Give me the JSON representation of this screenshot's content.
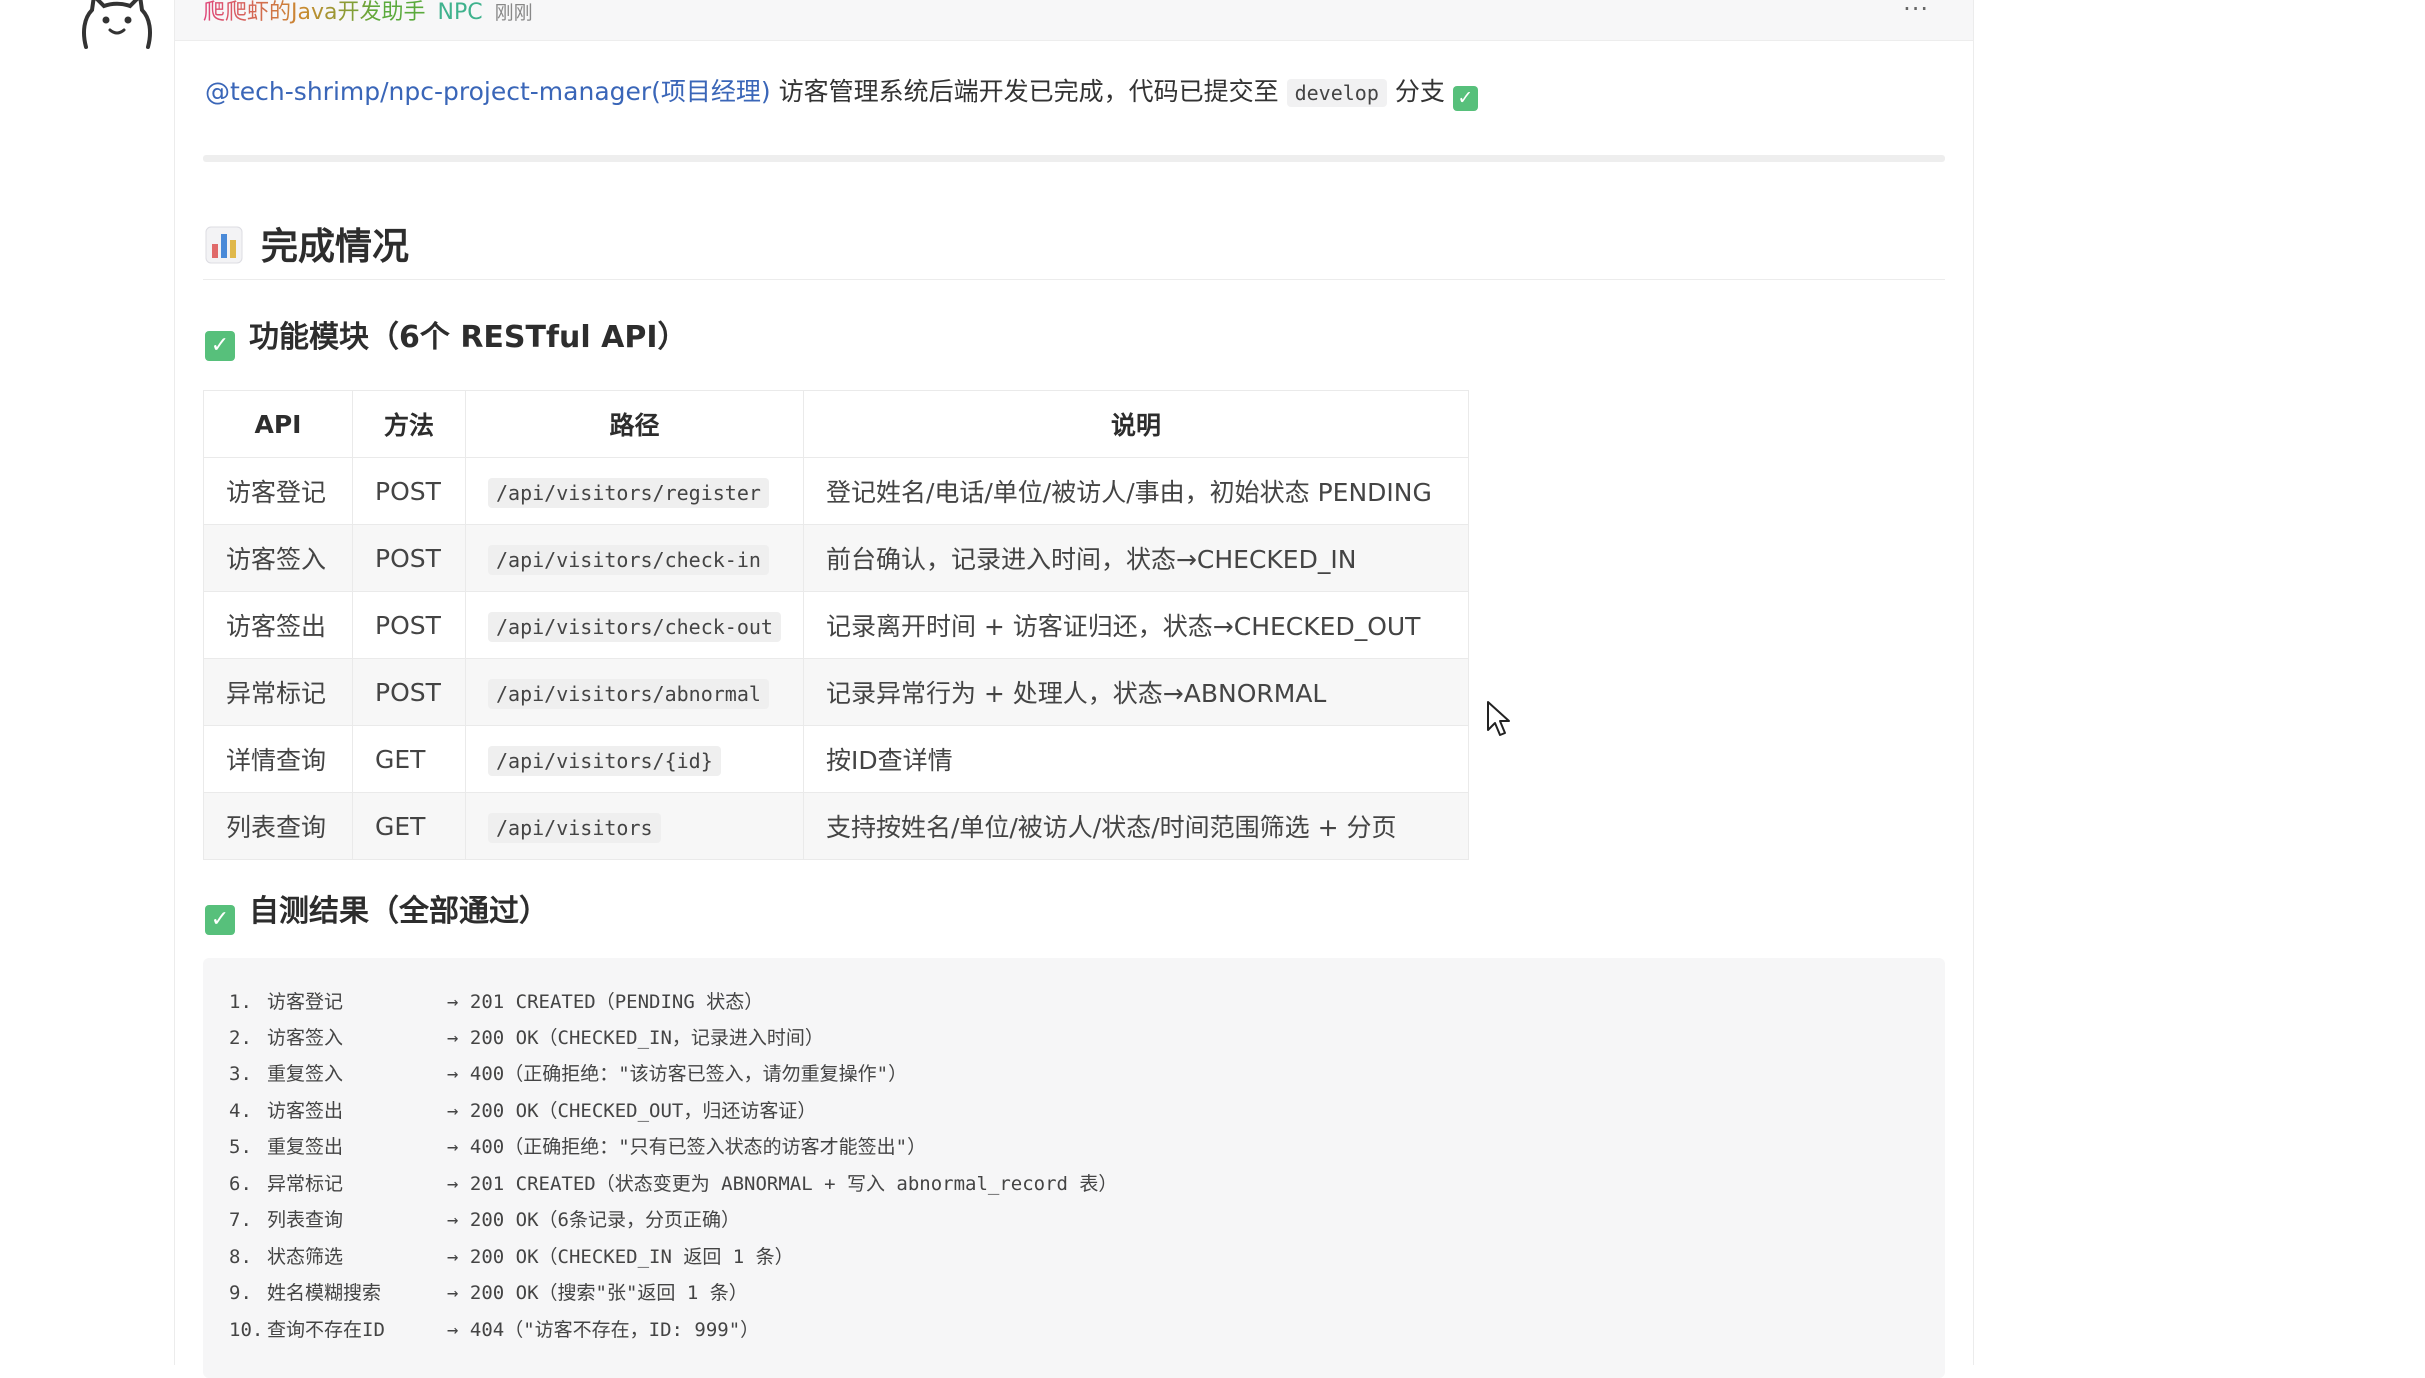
{
  "message": {
    "sender_name": "爬爬虾的Java开发助手",
    "sender_tag": "NPC",
    "time": "刚刚",
    "more_label": "···",
    "intro": {
      "mention": "@tech-shrimp/npc-project-manager(项目经理)",
      "text": " 访客管理系统后端开发已完成，代码已提交至 ",
      "branch": "develop",
      "suffix": " 分支 ",
      "check": "✓"
    }
  },
  "section": {
    "title": "完成情况",
    "modules_heading": "功能模块（6个 RESTful API）",
    "tests_heading": "自测结果（全部通过）"
  },
  "table": {
    "headers": [
      "API",
      "方法",
      "路径",
      "说明"
    ],
    "rows": [
      [
        "访客登记",
        "POST",
        "/api/visitors/register",
        "登记姓名/电话/单位/被访人/事由，初始状态 PENDING"
      ],
      [
        "访客签入",
        "POST",
        "/api/visitors/check-in",
        "前台确认，记录进入时间，状态→CHECKED_IN"
      ],
      [
        "访客签出",
        "POST",
        "/api/visitors/check-out",
        "记录离开时间 + 访客证归还，状态→CHECKED_OUT"
      ],
      [
        "异常标记",
        "POST",
        "/api/visitors/abnormal",
        "记录异常行为 + 处理人，状态→ABNORMAL"
      ],
      [
        "详情查询",
        "GET",
        "/api/visitors/{id}",
        "按ID查详情"
      ],
      [
        "列表查询",
        "GET",
        "/api/visitors",
        "支持按姓名/单位/被访人/状态/时间范围筛选 + 分页"
      ]
    ]
  },
  "tests": [
    {
      "num": "1.",
      "label": "访客登记",
      "result": "→ 201 CREATED（PENDING 状态）"
    },
    {
      "num": "2.",
      "label": "访客签入",
      "result": "→ 200 OK（CHECKED_IN，记录进入时间）"
    },
    {
      "num": "3.",
      "label": "重复签入",
      "result": "→ 400（正确拒绝：\"该访客已签入，请勿重复操作\"）"
    },
    {
      "num": "4.",
      "label": "访客签出",
      "result": "→ 200 OK（CHECKED_OUT，归还访客证）"
    },
    {
      "num": "5.",
      "label": "重复签出",
      "result": "→ 400（正确拒绝：\"只有已签入状态的访客才能签出\"）"
    },
    {
      "num": "6.",
      "label": "异常标记",
      "result": "→ 201 CREATED（状态变更为 ABNORMAL + 写入 abnormal_record 表）"
    },
    {
      "num": "7.",
      "label": "列表查询",
      "result": "→ 200 OK（6条记录，分页正确）"
    },
    {
      "num": "8.",
      "label": "状态筛选",
      "result": "→ 200 OK（CHECKED_IN 返回 1 条）"
    },
    {
      "num": "9.",
      "label": "姓名模糊搜索",
      "result": "→ 200 OK（搜索\"张\"返回 1 条）"
    },
    {
      "num": "10.",
      "label": "查询不存在ID",
      "result": "→ 404（\"访客不存在，ID: 999\"）"
    }
  ],
  "colors": {
    "mention": "#3a66b8",
    "check": "#57c07b",
    "npc_tag": "#3fb28d"
  }
}
